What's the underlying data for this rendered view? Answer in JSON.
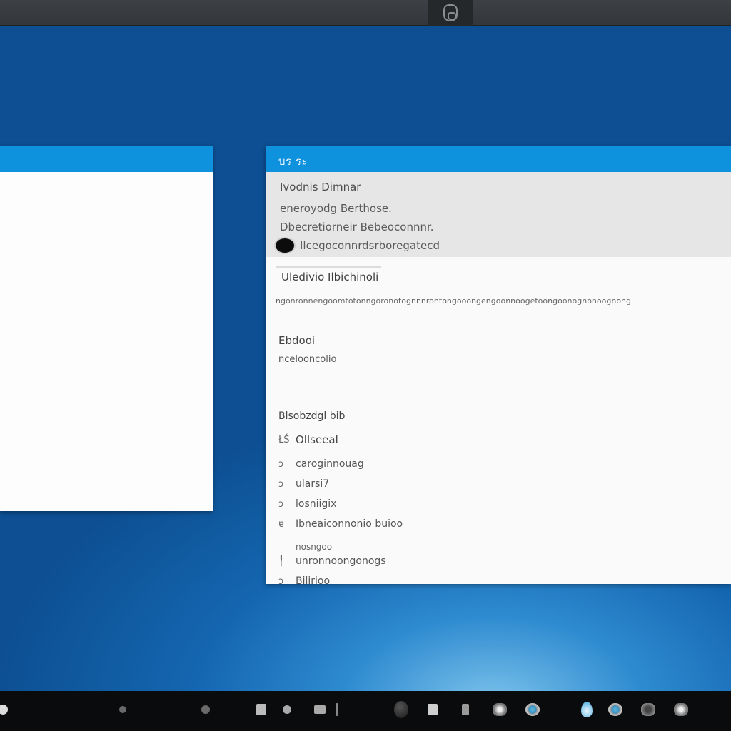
{
  "right_window": {
    "title": "บร ระ",
    "header": {
      "line1": "Ivodnis  Dimnar",
      "line2": "eneroyodg  Berthose.",
      "line3": "Dbecretiorneir  Bebeoconnnr.",
      "line4": "Ilcegoconnrdsrboregatecd"
    },
    "section": {
      "heading": "Uledivio  Ilbichinoli",
      "description": "ngonronnengoomtotonngoronotognnnrontongooongengoonnoogetoongoonognonoognong"
    },
    "field": {
      "label": "Ebdooi",
      "value": "ncelooncolio"
    },
    "options": {
      "heading": "Blsobzdgl bib",
      "items": [
        {
          "glyph": "ŁŚ",
          "label": "Ollseeal"
        },
        {
          "glyph": "ↄ",
          "label": "caroginnouag"
        },
        {
          "glyph": "ↄ",
          "label": "ularsi7"
        },
        {
          "glyph": "ↄ",
          "label": "losniigix"
        },
        {
          "glyph": "ɐ",
          "label": "Ibneaiconnonio  buioo"
        },
        {
          "glyph": "╿",
          "label": "nosngoo",
          "sub": true
        },
        {
          "glyph": "",
          "label": "unronnoongonogs"
        },
        {
          "glyph": "ↄ",
          "label": "Bilirioo"
        }
      ]
    }
  },
  "taskbar": {
    "icons": [
      "system-dot-icon",
      "dot-icon",
      "dot-icon",
      "app-icon",
      "app-icon",
      "app-icon",
      "app-icon",
      "globe-icon",
      "document-icon",
      "tool-icon",
      "sphere-icon",
      "eye-icon",
      "drop-icon",
      "eye-icon",
      "gear-icon",
      "gear-icon"
    ]
  }
}
